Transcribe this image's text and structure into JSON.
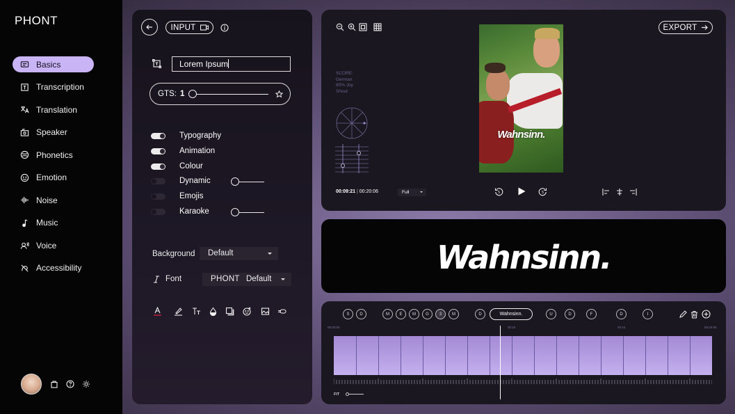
{
  "app": {
    "logo": "PHONT"
  },
  "sidebar": {
    "items": [
      {
        "label": "Basics",
        "icon": "caption-icon",
        "active": true
      },
      {
        "label": "Transcription",
        "icon": "transcription-icon"
      },
      {
        "label": "Translation",
        "icon": "translate-icon"
      },
      {
        "label": "Speaker",
        "icon": "speaker-icon"
      },
      {
        "label": "Phonetics",
        "icon": "phonetics-icon"
      },
      {
        "label": "Emotion",
        "icon": "emotion-icon"
      },
      {
        "label": "Noise",
        "icon": "noise-icon"
      },
      {
        "label": "Music",
        "icon": "music-icon"
      },
      {
        "label": "Voice",
        "icon": "voice-icon"
      },
      {
        "label": "Accessibility",
        "icon": "accessibility-icon"
      }
    ],
    "accent": "#c9b4f5"
  },
  "editor": {
    "input_label": "INPUT",
    "text_value": "Lorem Ipsum",
    "gts_label": "GTS:",
    "gts_value": "1",
    "toggles": [
      {
        "label": "Typography",
        "on": true
      },
      {
        "label": "Animation",
        "on": true
      },
      {
        "label": "Colour",
        "on": true
      },
      {
        "label": "Dynamic",
        "on": false,
        "slider": true
      },
      {
        "label": "Emojis",
        "on": false
      },
      {
        "label": "Karaoke",
        "on": false,
        "slider": true
      }
    ],
    "background_label": "Background",
    "background_value": "Default",
    "font_label": "Font",
    "font_value_brand": "PHONT",
    "font_value": "Default"
  },
  "preview": {
    "export_label": "EXPORT",
    "score_lines": [
      "SCORE:",
      "German",
      "80% Joy",
      "Shout"
    ],
    "video_caption": "Wahnsinn.",
    "time_current": "00:09:21",
    "time_total": "00:20:06",
    "zoom_value": "Full"
  },
  "caption": {
    "text": "Wahnsinn."
  },
  "timeline": {
    "chips": [
      "S",
      "D",
      "M",
      "E",
      "M",
      "G",
      "3",
      "M",
      "D",
      "U",
      "D",
      "F",
      "D",
      "I"
    ],
    "word": "Wahnsinn.",
    "ruler": [
      "00:00:00",
      "00:10",
      "00:15",
      "00:20:06"
    ],
    "fit_label": "FIT",
    "track_color": "#b9a2ea"
  }
}
